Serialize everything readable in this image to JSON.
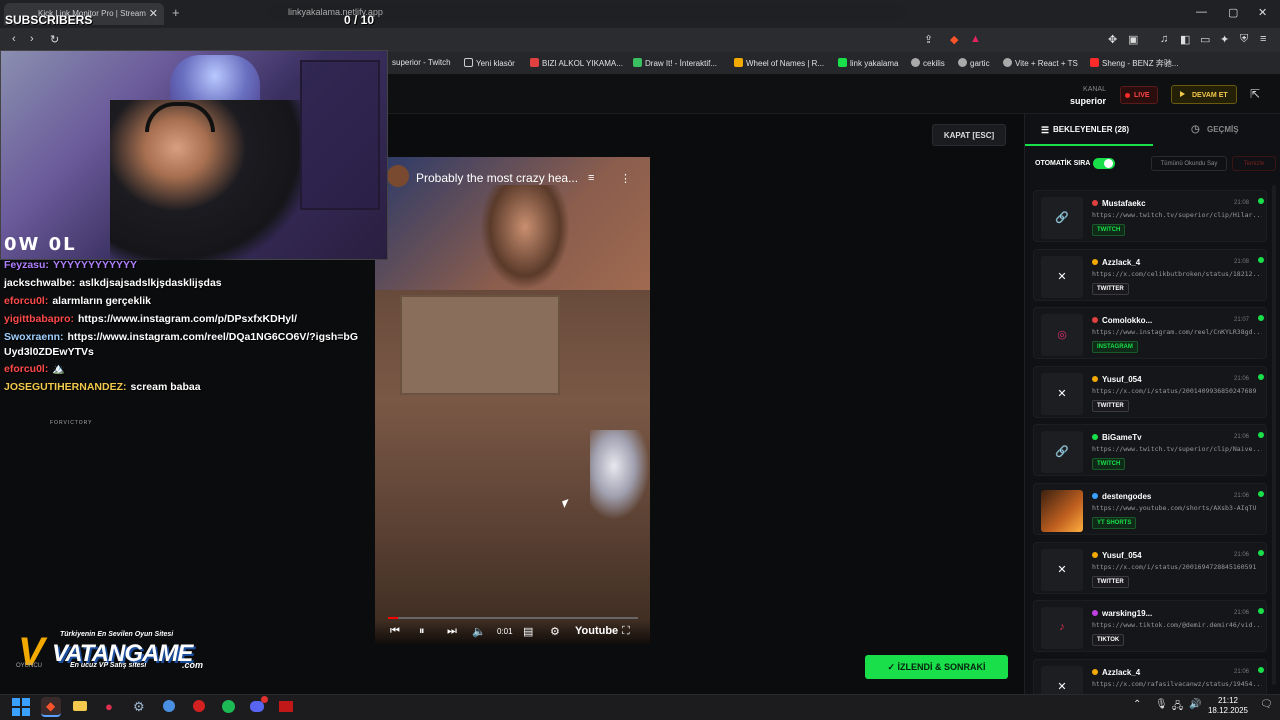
{
  "browser": {
    "tab_title": "Kick Link Monitor Pro | Stream",
    "address": "linkyakalama.netlify.app",
    "bookmarks": [
      "superior - Twitch",
      "Yeni klasör",
      "BIZI ALKOL YIKAMA...",
      "Draw It! - İnteraktif...",
      "Wheel of Names | R...",
      "link yakalama",
      "cekilis",
      "gartic",
      "Vite + React + TS",
      "Sheng - BENZ 奔驰..."
    ]
  },
  "overlay": {
    "subscribers_label": "SUBSCRIBERS",
    "subscribers_count": "0  / 10",
    "webcam_brand": "0W 0L"
  },
  "header": {
    "kanal_label": "KANAL",
    "kanal_name": "superior",
    "live_label": "LIVE",
    "devam_label": "DEVAM ET"
  },
  "main": {
    "kapat_label": "KAPAT [ESC]",
    "video_title": "Probably the most crazy hea...",
    "video_time": "0:01",
    "youtube_label": "Youtube",
    "izlendi_label": "İZLENDİ & SONRAKİ"
  },
  "sidebar": {
    "tab_waiting": "BEKLEYENLER (28)",
    "tab_history": "GEÇMİŞ",
    "auto_label": "OTOMATİK SIRA",
    "mark_all": "Tümünü Okundu Say",
    "clear": "Temizle",
    "cards": [
      {
        "user": "Mustafaekc",
        "time": "21:08",
        "url": "https://www.twitch.tv/superior/clip/Hilar...",
        "badge": "TWITCH",
        "kind": "twitch",
        "dot": "#e04040"
      },
      {
        "user": "Azzlack_4",
        "time": "21:08",
        "url": "https://x.com/celikbutbroken/status/18212...",
        "badge": "TWITTER",
        "kind": "twitter",
        "dot": "#f2a900"
      },
      {
        "user": "Comolokko...",
        "time": "21:07",
        "url": "https://www.instagram.com/reel/CnKYLR38gd...",
        "badge": "INSTAGRAM",
        "kind": "insta",
        "dot": "#e04040"
      },
      {
        "user": "Yusuf_054",
        "time": "21:06",
        "url": "https://x.com/i/status/2001409936850247689",
        "badge": "TWITTER",
        "kind": "twitter",
        "dot": "#f2a900"
      },
      {
        "user": "BiGameTv",
        "time": "21:06",
        "url": "https://www.twitch.tv/superior/clip/Naive...",
        "badge": "TWITCH",
        "kind": "twitch",
        "dot": "#19e04a"
      },
      {
        "user": "destengodes",
        "time": "21:06",
        "url": "https://www.youtube.com/shorts/AXsb3-AIqTU",
        "badge": "YT SHORTS",
        "kind": "yt",
        "dot": "#3aa0ff"
      },
      {
        "user": "Yusuf_054",
        "time": "21:06",
        "url": "https://x.com/i/status/2001694728845160591",
        "badge": "TWITTER",
        "kind": "twitter",
        "dot": "#f2a900"
      },
      {
        "user": "warsking19...",
        "time": "21:06",
        "url": "https://www.tiktok.com/@demir.demir46/vid...",
        "badge": "TIKTOK",
        "kind": "tiktok",
        "dot": "#c040e0"
      },
      {
        "user": "Azzlack_4",
        "time": "21:06",
        "url": "https://x.com/rafasilvacanwz/status/19454...",
        "badge": "",
        "kind": "twitter",
        "dot": "#f2a900"
      }
    ]
  },
  "chat": [
    {
      "name": "Feyzasu:",
      "color": "#b080ff",
      "msg": "YYYYYYYYYYYY"
    },
    {
      "name": "jackschwalbe:",
      "color": "#ffffff",
      "msg": "aslkdjsajsadslkjşdasklijşdas"
    },
    {
      "name": "eforcu0l:",
      "color": "#ff4a4a",
      "msg": "alarmların gerçeklik"
    },
    {
      "name": "yigittbabapro:",
      "color": "#ff4a4a",
      "msg": "https://www.instagram.com/p/DPsxfxKDHyl/"
    },
    {
      "name": "Swoxraenn:",
      "color": "#9fd0ff",
      "msg": "https://www.instagram.com/reel/DQa1NG6CO6V/?igsh=bGUyd3l0ZDEwYTVs"
    },
    {
      "name": "eforcu0l:",
      "color": "#ff4a4a",
      "msg": "🏔️"
    },
    {
      "name": "JOSEGUTIHERNANDEZ:",
      "color": "#f2c94c",
      "msg": "scream babaa"
    }
  ],
  "chat_mini": "FORVICTORY",
  "sponsor": {
    "tagline": "Türkiyenin En Sevilen Oyun Sitesi",
    "name": "VATANGAME",
    "sub": "En ucuz VP Satış sitesi",
    "com": ".com",
    "left": "OYUNCU"
  },
  "taskbar": {
    "time": "21:12",
    "date": "18.12.2025"
  }
}
